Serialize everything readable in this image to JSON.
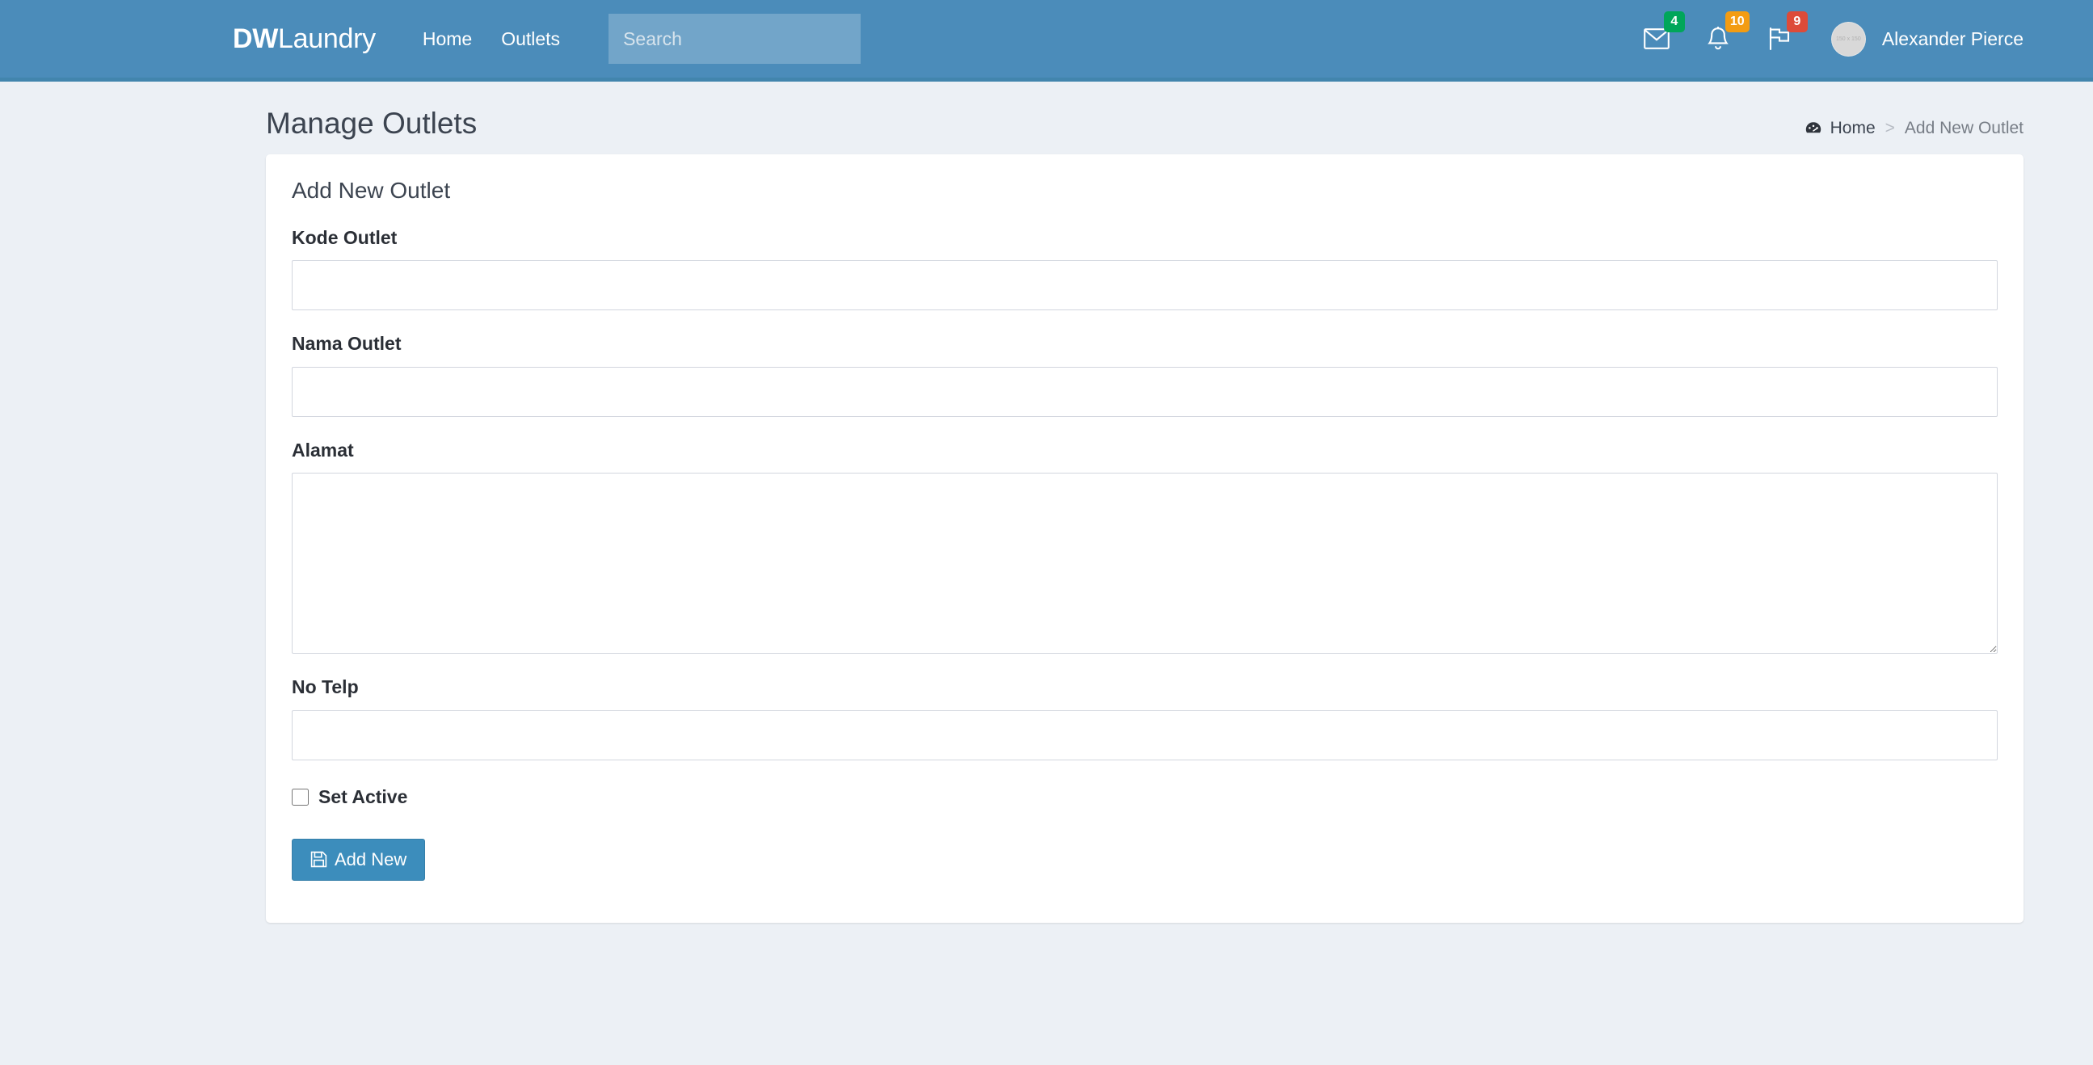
{
  "navbar": {
    "brand_bold": "DW",
    "brand_light": "Laundry",
    "links": [
      {
        "label": "Home"
      },
      {
        "label": "Outlets"
      }
    ],
    "search": {
      "placeholder": "Search",
      "value": ""
    },
    "icons": [
      {
        "name": "envelope-icon",
        "badge": "4",
        "badge_color": "#00a65a"
      },
      {
        "name": "bell-icon",
        "badge": "10",
        "badge_color": "#f39c12"
      },
      {
        "name": "flag-icon",
        "badge": "9",
        "badge_color": "#dd4b39"
      }
    ],
    "user": {
      "name": "Alexander Pierce",
      "avatar_alt": "150 x 150"
    },
    "background_color": "#4b8cba"
  },
  "header": {
    "title": "Manage Outlets",
    "breadcrumb": {
      "icon": "dashboard-icon",
      "home": "Home",
      "separator": ">",
      "current": "Add New Outlet"
    }
  },
  "card": {
    "title": "Add New Outlet",
    "fields": [
      {
        "label": "Kode Outlet",
        "value": "",
        "placeholder": "",
        "type": "text"
      },
      {
        "label": "Nama Outlet",
        "value": "",
        "placeholder": "",
        "type": "text"
      },
      {
        "label": "Alamat",
        "value": "",
        "placeholder": "",
        "type": "textarea"
      },
      {
        "label": "No Telp",
        "value": "",
        "placeholder": "",
        "type": "text"
      }
    ],
    "checkbox": {
      "label": "Set Active",
      "checked": false
    },
    "submit": {
      "label": "Add New",
      "icon": "save-icon",
      "color": "#3c8dbc"
    }
  }
}
